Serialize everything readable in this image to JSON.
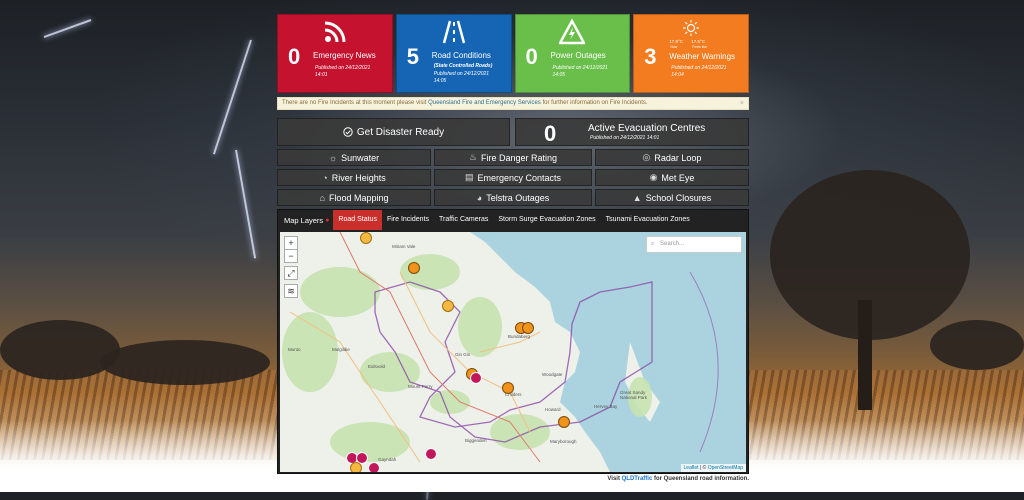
{
  "tiles": [
    {
      "count": "0",
      "label": "Emergency News",
      "published": "Published on 24/12/2021 14:01",
      "color": "#c4122f",
      "icon": "rss-icon"
    },
    {
      "count": "5",
      "label": "Road Conditions",
      "sub": "(State Controlled Roads)",
      "published": "Published on 24/12/2021 14:05",
      "color": "#1565b4",
      "icon": "road-icon"
    },
    {
      "count": "0",
      "label": "Power Outages",
      "published": "Published on 24/12/2021 14:05",
      "color": "#6abf4b",
      "icon": "lightning-icon"
    },
    {
      "count": "3",
      "label": "Weather Warnings",
      "published": "Published on 24/12/2021 14:04",
      "color": "#f47c20",
      "icon": "sun-icon",
      "temps": [
        "17.8°C",
        "17.5°C"
      ],
      "temp_labels": [
        "Now",
        "Feels like"
      ]
    }
  ],
  "notice": {
    "pre": "There are no Fire Incidents at this moment please visit ",
    "link": "Queensland Fire and Emergency Services",
    "post": " for further information on Fire Incidents.",
    "close": "×"
  },
  "disaster_ready": "Get Disaster Ready",
  "evacuation": {
    "count": "0",
    "title": "Active Evacuation Centres",
    "published": "Published on 24/12/2021 14:01"
  },
  "links": [
    "Sunwater",
    "Fire Danger Rating",
    "Radar Loop",
    "River Heights",
    "Emergency Contacts",
    "Met Eye",
    "Flood Mapping",
    "Telstra Outages",
    "School Closures"
  ],
  "map": {
    "layers_label": "Map Layers",
    "tabs": [
      "Road Status",
      "Fire Incidents",
      "Traffic Cameras",
      "Storm Surge Evacuation Zones",
      "Tsunami Evacuation Zones"
    ],
    "active_tab": "Road Status",
    "search_placeholder": "Search...",
    "zoom_in": "+",
    "zoom_out": "−",
    "attribution_leaflet": "Leaflet",
    "attribution_sep": " | © ",
    "attribution_osm": "OpenStreetMap",
    "towns": [
      "Miriam Vale",
      "Bundaberg",
      "Gin Gin",
      "Childers",
      "Hervey Bay",
      "Maryborough",
      "Gayndah",
      "Biggenden",
      "Mount Perry",
      "Monto",
      "Woodgate",
      "Howard",
      "Mulgildie",
      "Eidsvold",
      "Great Sandy National Park"
    ]
  },
  "footer": {
    "pre": "Visit ",
    "link": "QLDTraffic",
    "post": " for Queensland road information."
  },
  "colors": {
    "accent_red": "#c9302c",
    "button_bg": "#3a3a3a",
    "water": "#aad3df",
    "land": "#eef0ea"
  }
}
